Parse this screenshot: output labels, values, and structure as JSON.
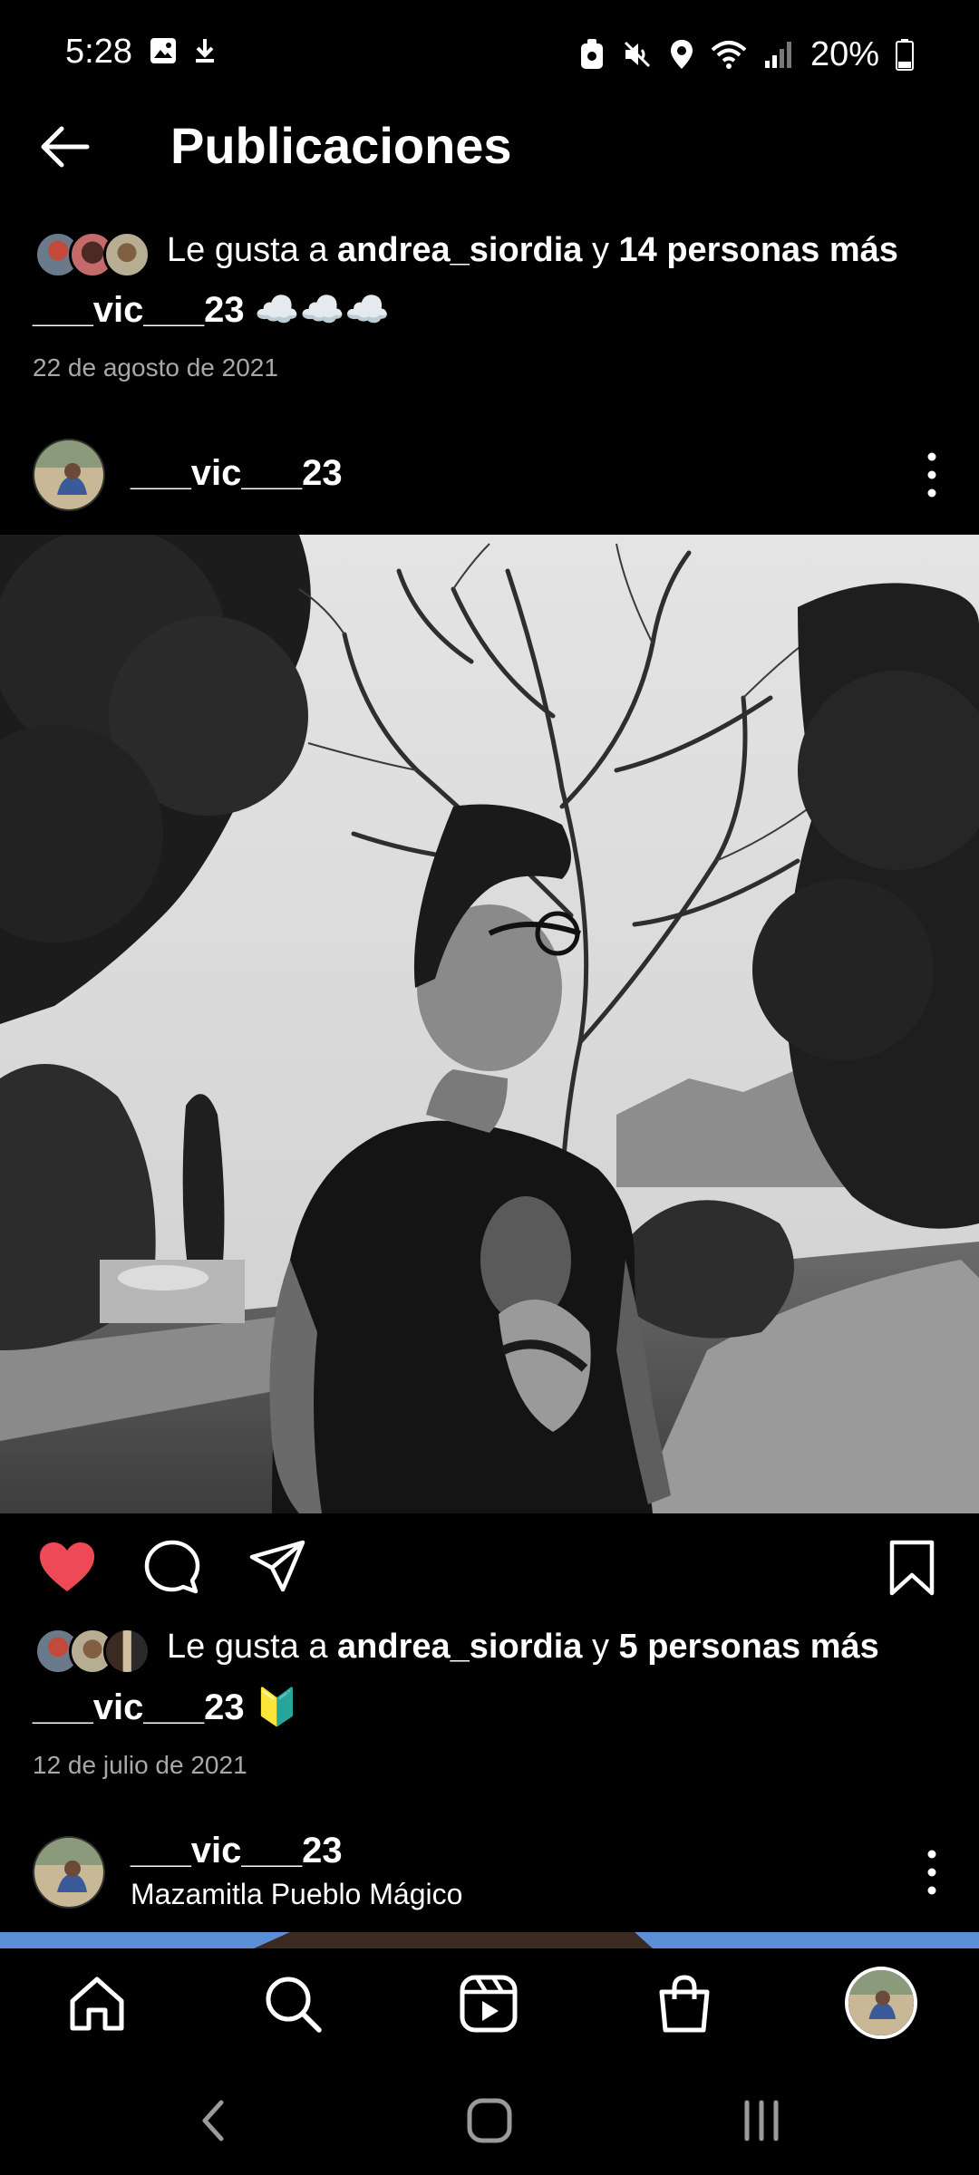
{
  "status_bar": {
    "time": "5:28",
    "battery": "20%",
    "left_icons": [
      "gallery-icon",
      "download-icon"
    ],
    "right_icons": [
      "vpn-icon",
      "mute-icon",
      "location-icon",
      "wifi-icon",
      "signal-icon",
      "battery-icon"
    ]
  },
  "header": {
    "title": "Publicaciones",
    "back_icon": "arrow-left-icon"
  },
  "post1": {
    "likes_prefix": "Le gusta a ",
    "likes_user": "andrea_siordia",
    "likes_connector": " y ",
    "likes_others": "14 personas más",
    "caption_user": "___vic___23",
    "caption_text": "☁️☁️☁️",
    "date": "22 de agosto de 2021"
  },
  "post2": {
    "username": "___vic___23",
    "likes_prefix": "Le gusta a ",
    "likes_user": "andrea_siordia",
    "likes_connector": " y ",
    "likes_others": "5 personas más",
    "caption_user": "___vic___23",
    "caption_text": "🔰",
    "date": "12 de julio de 2021",
    "liked": true
  },
  "post3": {
    "username": "___vic___23",
    "location": "Mazamitla Pueblo Mágico"
  },
  "tab_bar": {
    "tabs": [
      "home-icon",
      "search-icon",
      "reels-icon",
      "shop-icon",
      "profile-avatar"
    ]
  },
  "colors": {
    "background": "#000000",
    "like_red": "#ed4956",
    "secondary_text": "#a8a8a8"
  }
}
